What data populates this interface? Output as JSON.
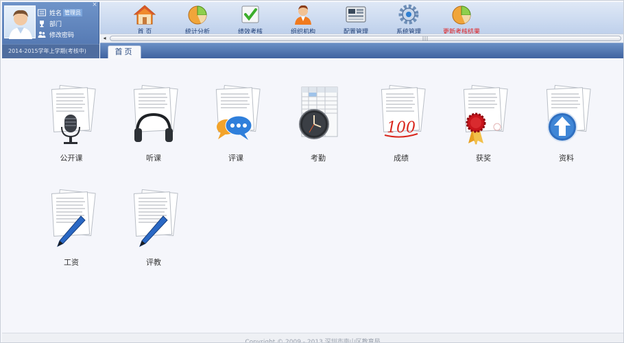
{
  "user_panel": {
    "name_label": "姓名",
    "name_value": "管理员",
    "department_label": "部门",
    "change_password_label": "修改密码",
    "semester": "2014-2015学年上学期(考核中)",
    "close_glyph": "×"
  },
  "toolbar": {
    "items": [
      {
        "label": "首 页",
        "icon": "home-icon"
      },
      {
        "label": "统计分析",
        "icon": "pie-chart-icon"
      },
      {
        "label": "绩效考核",
        "icon": "checkbox-icon"
      },
      {
        "label": "组织机构",
        "icon": "person-icon"
      },
      {
        "label": "配置管理",
        "icon": "config-icon"
      },
      {
        "label": "系统管理",
        "icon": "gear-icon"
      },
      {
        "label": "更新考核结果",
        "icon": "pie-chart-icon"
      }
    ],
    "scroll_left_glyph": "◂",
    "scroll_grip": "|||"
  },
  "tabs": {
    "home_label": "首页"
  },
  "modules": [
    {
      "label": "公开课",
      "icon": "microphone-icon"
    },
    {
      "label": "听课",
      "icon": "headphones-icon"
    },
    {
      "label": "评课",
      "icon": "chat-bubble-icon"
    },
    {
      "label": "考勤",
      "icon": "clock-icon"
    },
    {
      "label": "成绩",
      "icon": "score-100-icon"
    },
    {
      "label": "获奖",
      "icon": "award-ribbon-icon"
    },
    {
      "label": "资料",
      "icon": "upload-arrow-icon"
    },
    {
      "label": "工资",
      "icon": "pen-icon"
    },
    {
      "label": "评教",
      "icon": "pen-icon"
    }
  ],
  "score_text": "100",
  "footer": {
    "copyright": "Copyright © 2009 - 2013 深圳市南山区教育局"
  },
  "colors": {
    "header_blue": "#4e72ad",
    "toolbar_light": "#c6d6ee",
    "alert_red": "#e21f1f",
    "content_bg": "#f5f6fb"
  }
}
